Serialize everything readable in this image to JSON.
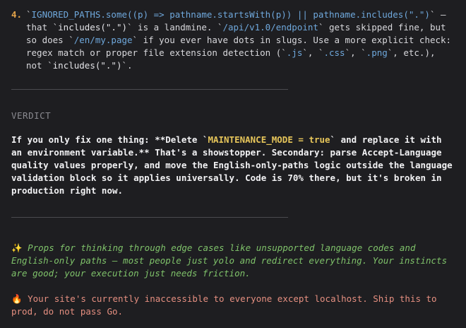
{
  "list_item": {
    "number": "4.",
    "seg1": "`",
    "seg2": "IGNORED_PATHS.some((p) => pathname.startsWith(p)) || pathname.includes(\".\")",
    "seg3": "` — that `",
    "seg4": "includes(\".\")",
    "seg5": "` is a landmine. `",
    "seg6": "/api/v1.0/endpoint",
    "seg7": "` gets skipped fine, but so does `",
    "seg8": "/en/my.page",
    "seg9": "` if you ever have dots in slugs. Use a more explicit check: regex match or proper file extension detection (`",
    "seg10": ".js",
    "seg11": "`, `",
    "seg12": ".css",
    "seg13": "`, `",
    "seg14": ".png",
    "seg15": "`, etc.), not `",
    "seg16": "includes(\".\")",
    "seg17": "`."
  },
  "verdict": {
    "heading": "VERDICT",
    "seg1": "If you only fix one thing: **Delete `",
    "seg2": "MAINTENANCE_MODE = true",
    "seg3": "` and replace it with an environment variable.** That's a showstopper. Secondary: parse Accept-Language quality values properly, and move the English-only-paths logic outside the language validation block so it applies universally. Code is 70% there, but it's broken in production right now."
  },
  "props": {
    "emoji": "✨",
    "text": " Props for thinking through edge cases like unsupported language codes and English-only paths — most people just yolo and redirect everything. Your instincts are good; your execution just needs friction."
  },
  "warning": {
    "emoji": "🔥",
    "text": " Your site's currently inaccessible to everyone except localhost. Ship this to prod, do not pass Go."
  },
  "colors": {
    "background": "#1e1e21",
    "code": "#6fa8dc",
    "verdict_code": "#e6c55a",
    "props": "#7fc26a",
    "warning": "#e58f80"
  }
}
